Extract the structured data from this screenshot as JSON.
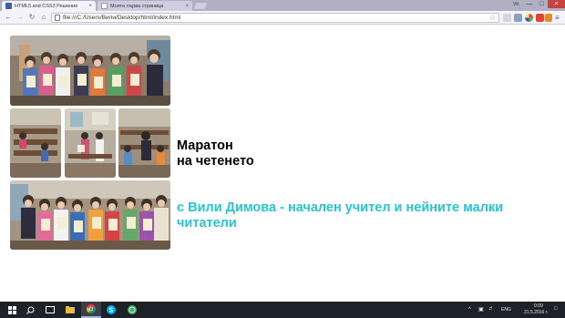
{
  "browser": {
    "tabs": [
      {
        "title": "HTML5 and CSS3 Решение",
        "active": true,
        "favicon": "book-icon"
      },
      {
        "title": "Моята първа страница",
        "active": false,
        "favicon": "page-icon"
      }
    ],
    "user_label": "Vili",
    "url": "file:///C:/Users/Вили/Desktop/html/index.html"
  },
  "page": {
    "heading_line1": "Маратон",
    "heading_line2": "на четенето",
    "subheading": "с Вили Димова - начален учител и нейните малки читатели"
  },
  "photos": [
    {
      "name": "class-group-photo-top"
    },
    {
      "name": "classroom-photo-left"
    },
    {
      "name": "classroom-photo-middle"
    },
    {
      "name": "classroom-photo-right"
    },
    {
      "name": "class-group-photo-bottom"
    }
  ],
  "taskbar": {
    "language": "ENG",
    "time": "0:09",
    "date": "21.5.2016 г."
  },
  "colors": {
    "accent": "#27c4d6",
    "taskbar": "#1d2228",
    "chrome": "#f4f3fa"
  }
}
